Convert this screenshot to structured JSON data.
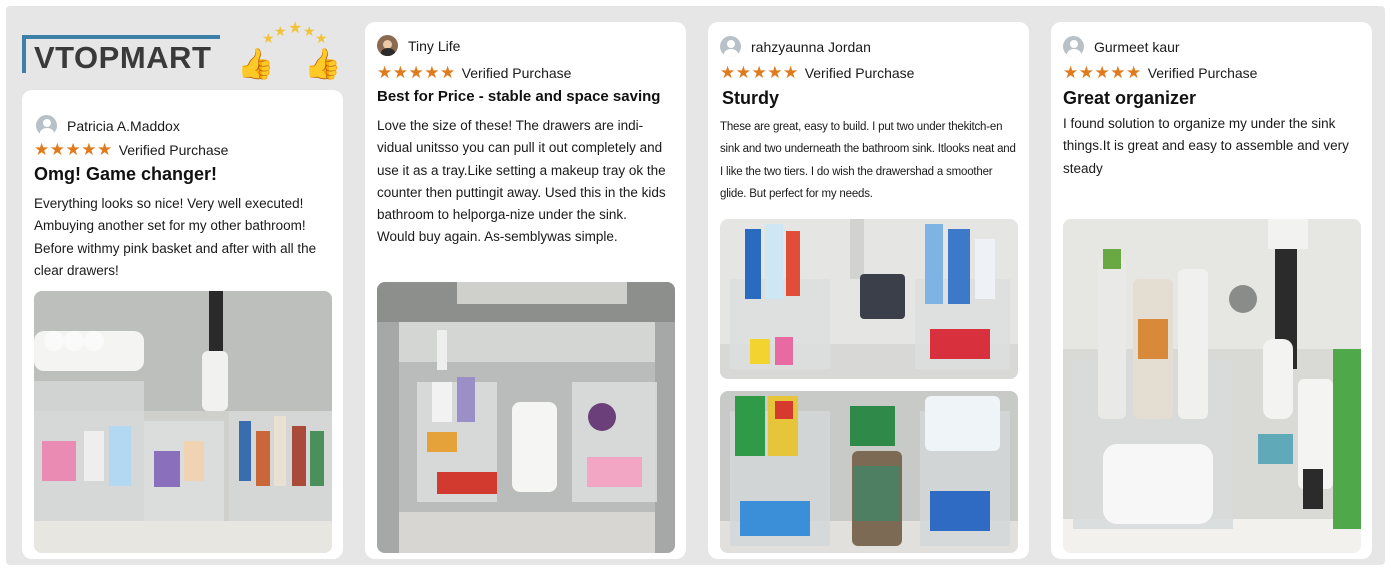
{
  "brand": {
    "name": "VTOPMART",
    "accent": "#3d7fa6"
  },
  "star_color": "#e07b1d",
  "reviews": [
    {
      "reviewer": "Patricia A.Maddox",
      "stars": "★★★★★",
      "verified": "Verified Purchase",
      "title": "Omg! Game changer!",
      "body": "Everything looks so nice! Very well executed! Ambuying another set for my other bathroom! Before withmy pink basket and after with all the clear drawers!"
    },
    {
      "reviewer": "Tiny Life",
      "stars": "★★★★★",
      "verified": "Verified Purchase",
      "title": "Best for Price - stable and space saving",
      "body": "Love the size of these! The drawers are indi-vidual unitsso you can pull it out completely and use it as a tray.Like setting a makeup tray ok the counter then puttingit away. Used this in the kids bathroom to helporga-nize under the sink. Would buy again. As-semblywas simple."
    },
    {
      "reviewer": "rahzyaunna Jordan",
      "stars": "★★★★★",
      "verified": "Verified Purchase",
      "title": "Sturdy",
      "body": "These are great, easy to build. I put two under thekitch-en sink and two underneath the bathroom sink. Itlooks neat and I like the two tiers. I do wish the drawershad a smoother glide. But perfect for my needs."
    },
    {
      "reviewer": "Gurmeet kaur",
      "stars": "★★★★★",
      "verified": "Verified Purchase",
      "title": "Great organizer",
      "body": "I found solution to organize my under the sink things.It is great and easy to assemble and very steady"
    }
  ]
}
